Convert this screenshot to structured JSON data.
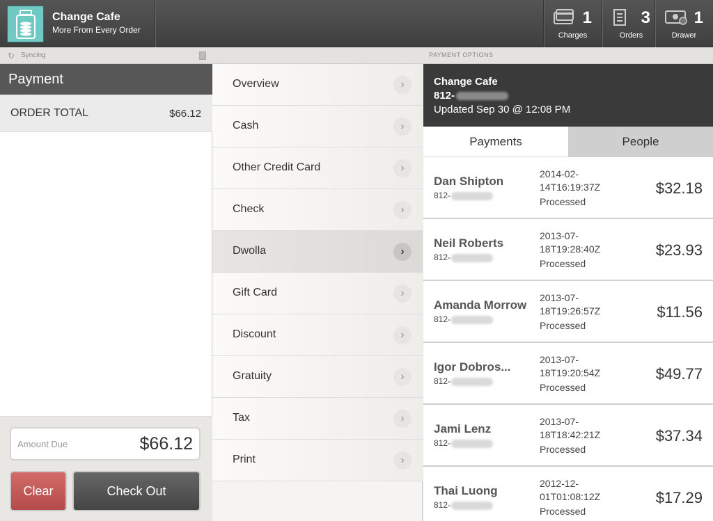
{
  "brand": {
    "title": "Change Cafe",
    "subtitle": "More From Every Order",
    "logo_icon": "jar-icon"
  },
  "stats": [
    {
      "label": "Charges",
      "count": "1",
      "icon": "credit-card-icon"
    },
    {
      "label": "Orders",
      "count": "3",
      "icon": "receipt-icon"
    },
    {
      "label": "Drawer",
      "count": "1",
      "icon": "cash-drawer-icon"
    }
  ],
  "sync": {
    "text": "Syncing"
  },
  "options_title": "PAYMENT OPTIONS",
  "payment": {
    "title": "Payment",
    "order_total_label": "ORDER TOTAL",
    "order_total_value": "$66.12",
    "amount_due_label": "Amount Due",
    "amount_due_value": "$66.12",
    "clear_label": "Clear",
    "checkout_label": "Check Out"
  },
  "menu": {
    "items": [
      {
        "label": "Overview"
      },
      {
        "label": "Cash"
      },
      {
        "label": "Other Credit Card"
      },
      {
        "label": "Check"
      },
      {
        "label": "Dwolla"
      },
      {
        "label": "Gift Card"
      },
      {
        "label": "Discount"
      },
      {
        "label": "Gratuity"
      },
      {
        "label": "Tax"
      },
      {
        "label": "Print"
      }
    ],
    "active_index": 4
  },
  "customer": {
    "name": "Change Cafe",
    "phone_prefix": "812-",
    "updated": "Updated Sep 30 @ 12:08 PM"
  },
  "tabs": {
    "payments": "Payments",
    "people": "People"
  },
  "payments": [
    {
      "name": "Dan Shipton",
      "phone_prefix": "812-",
      "date_line1": "2014-02-",
      "date_line2": "14T16:19:37Z",
      "status": "Processed",
      "amount": "$32.18"
    },
    {
      "name": "Neil Roberts",
      "phone_prefix": "812-",
      "date_line1": "2013-07-",
      "date_line2": "18T19:28:40Z",
      "status": "Processed",
      "amount": "$23.93"
    },
    {
      "name": "Amanda Morrow",
      "phone_prefix": "812-",
      "date_line1": "2013-07-",
      "date_line2": "18T19:26:57Z",
      "status": "Processed",
      "amount": "$11.56"
    },
    {
      "name": "Igor Dobros...",
      "phone_prefix": "812-",
      "date_line1": "2013-07-",
      "date_line2": "18T19:20:54Z",
      "status": "Processed",
      "amount": "$49.77"
    },
    {
      "name": "Jami Lenz",
      "phone_prefix": "812-",
      "date_line1": "2013-07-",
      "date_line2": "18T18:42:21Z",
      "status": "Processed",
      "amount": "$37.34"
    },
    {
      "name": "Thai Luong",
      "phone_prefix": "812-",
      "date_line1": "2012-12-",
      "date_line2": "01T01:08:12Z",
      "status": "Processed",
      "amount": "$17.29"
    }
  ],
  "colors": {
    "clear_button": "#c65a58",
    "header_dark": "#3a3a3a",
    "logo_teal": "#6fcac4"
  }
}
